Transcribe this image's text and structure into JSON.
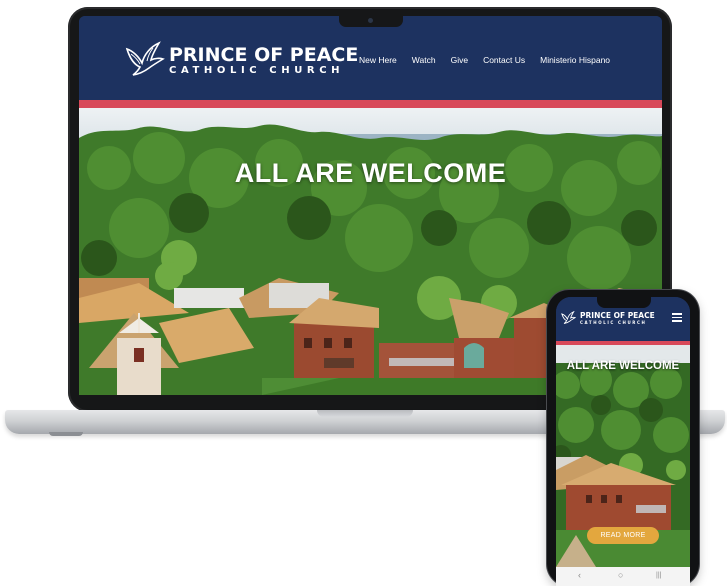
{
  "site": {
    "logo_line1": "PRINCE OF PEACE",
    "logo_line2": "CATHOLIC CHURCH",
    "nav": [
      "New Here",
      "Watch",
      "Give",
      "Contact Us",
      "Ministerio Hispano"
    ],
    "hero_title": "ALL ARE WELCOME"
  },
  "mobile": {
    "hero_title": "ALL ARE WELCOME",
    "cta_label": "READ MORE",
    "nav_back": "‹",
    "nav_home": "○",
    "nav_recent": "|||"
  },
  "colors": {
    "header_navy": "#1d3260",
    "accent_red": "#d8495a",
    "cta_gold": "#e3a73e"
  },
  "icons": [
    "dove-logo-icon",
    "hamburger-menu-icon",
    "back-icon",
    "home-icon",
    "recent-apps-icon"
  ]
}
